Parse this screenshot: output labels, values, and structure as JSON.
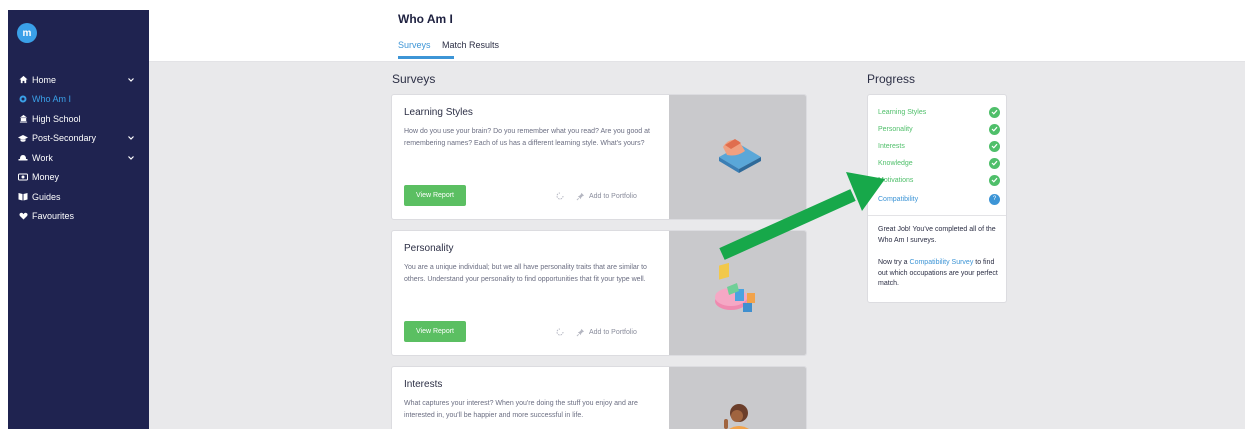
{
  "app": {
    "logo_letter": "m"
  },
  "sidebar": {
    "items": [
      {
        "label": "Home",
        "icon": "home-icon",
        "has_chevron": true,
        "active": false
      },
      {
        "label": "Who Am I",
        "icon": "dot-icon",
        "has_chevron": false,
        "active": true
      },
      {
        "label": "High School",
        "icon": "school-icon",
        "has_chevron": false,
        "active": false
      },
      {
        "label": "Post-Secondary",
        "icon": "graduation-cap-icon",
        "has_chevron": true,
        "active": false
      },
      {
        "label": "Work",
        "icon": "hardhat-icon",
        "has_chevron": true,
        "active": false
      },
      {
        "label": "Money",
        "icon": "money-icon",
        "has_chevron": false,
        "active": false
      },
      {
        "label": "Guides",
        "icon": "book-icon",
        "has_chevron": false,
        "active": false
      },
      {
        "label": "Favourites",
        "icon": "heart-icon",
        "has_chevron": false,
        "active": false
      }
    ]
  },
  "header": {
    "title": "Who Am I",
    "tabs": [
      {
        "label": "Surveys",
        "active": true
      },
      {
        "label": "Match Results",
        "active": false
      }
    ]
  },
  "main": {
    "surveys_title": "Surveys",
    "progress_title": "Progress",
    "cards": [
      {
        "title": "Learning Styles",
        "description": "How do you use your brain? Do you remember what you read? Are you good at remembering names? Each of us has a different learning style. What's yours?",
        "button_label": "View Report",
        "portfolio_label": "Add to Portfolio"
      },
      {
        "title": "Personality",
        "description": "You are a unique individual; but we all have personality traits that are similar to others. Understand your personality to find opportunities that fit your type well.",
        "button_label": "View Report",
        "portfolio_label": "Add to Portfolio"
      },
      {
        "title": "Interests",
        "description": "What captures your interest? When you're doing the stuff you enjoy and are interested in, you'll be happier and more successful in life.",
        "button_label": "",
        "portfolio_label": ""
      }
    ]
  },
  "progress": {
    "items": [
      {
        "label": "Learning Styles",
        "status": "complete"
      },
      {
        "label": "Personality",
        "status": "complete"
      },
      {
        "label": "Interests",
        "status": "complete"
      },
      {
        "label": "Knowledge",
        "status": "complete"
      },
      {
        "label": "Motivations",
        "status": "complete"
      },
      {
        "label": "Compatibility",
        "status": "pending",
        "badge": "?"
      }
    ],
    "message_1": "Great Job! You've completed all of the Who Am I surveys.",
    "message_2_prefix": "Now try a ",
    "message_2_link": "Compatibility Survey",
    "message_2_suffix": " to find out which occupations are your perfect match."
  },
  "colors": {
    "sidebar_bg": "#1f2350",
    "accent_blue": "#3d95d6",
    "success_green": "#4fbf6a",
    "button_green": "#5bbf62",
    "arrow_green": "#17a84a"
  }
}
